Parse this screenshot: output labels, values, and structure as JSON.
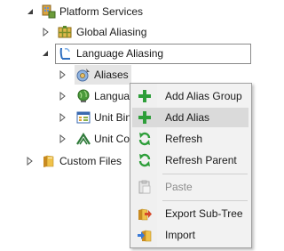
{
  "tree": {
    "nodes": [
      {
        "label": "Platform Services",
        "icon": "platform-services-icon",
        "expanded": true
      },
      {
        "label": "Global Aliasing",
        "icon": "global-aliasing-icon",
        "expanded": false
      },
      {
        "label": "Language Aliasing",
        "icon": "language-aliasing-icon",
        "expanded": true,
        "selected": true
      },
      {
        "label": "Aliases",
        "icon": "aliases-icon",
        "expanded": false
      },
      {
        "label": "Languag",
        "icon": "globe-icon",
        "expanded": false
      },
      {
        "label": "Unit Bin",
        "icon": "unit-binding-icon",
        "expanded": false
      },
      {
        "label": "Unit Cor",
        "icon": "unit-connection-icon",
        "expanded": false
      },
      {
        "label": "Custom Files",
        "icon": "folder-icon",
        "expanded": false
      }
    ]
  },
  "context_menu": {
    "items": [
      {
        "label": "Add Alias Group",
        "icon": "add-icon",
        "enabled": true
      },
      {
        "label": "Add Alias",
        "icon": "add-icon",
        "enabled": true,
        "hovered": true
      },
      {
        "label": "Refresh",
        "icon": "refresh-icon",
        "enabled": true
      },
      {
        "label": "Refresh Parent",
        "icon": "refresh-icon",
        "enabled": true
      },
      {
        "label": "Paste",
        "icon": "paste-icon",
        "enabled": false
      },
      {
        "label": "Export Sub-Tree",
        "icon": "export-icon",
        "enabled": true
      },
      {
        "label": "Import",
        "icon": "import-icon",
        "enabled": true
      }
    ]
  },
  "colors": {
    "menu_background": "#f2f2f2",
    "menu_hover": "#dadada",
    "selection_border": "#8a8a8a",
    "add_green": "#2e9e3a",
    "disabled_text": "#8c8c8c"
  }
}
